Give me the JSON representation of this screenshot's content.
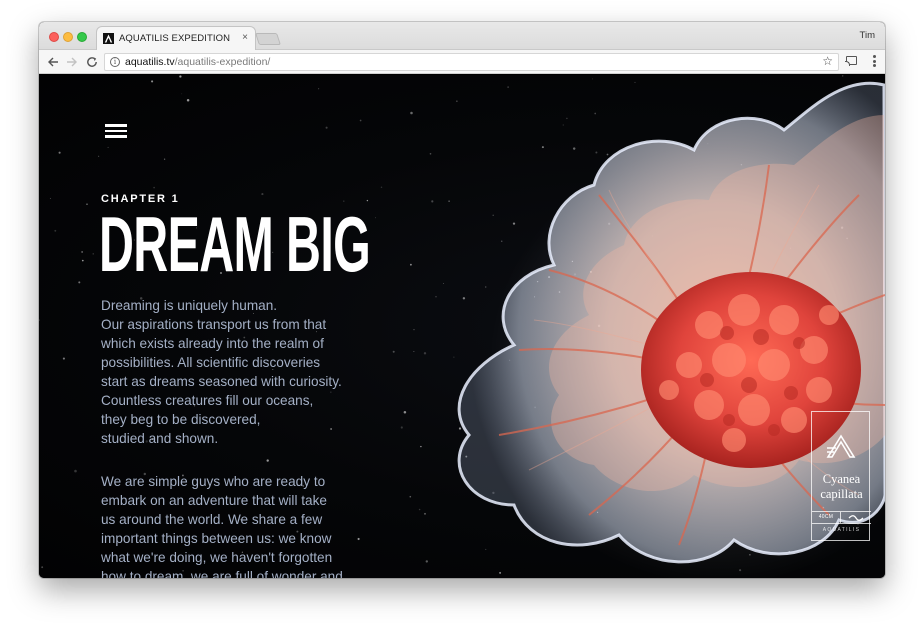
{
  "browser": {
    "tab_title": "AQUATILIS EXPEDITION",
    "tab_close": "×",
    "profile_name": "Tim",
    "url_host": "aquatilis.tv",
    "url_path": "/aquatilis-expedition/",
    "icons": [
      "back-arrow-icon",
      "forward-arrow-icon",
      "reload-icon",
      "info-icon",
      "star-icon",
      "cast-icon",
      "kebab-menu-icon",
      "aquatilis-favicon",
      "close-icon"
    ],
    "colors": {
      "traffic_red": "#fc605c",
      "traffic_yellow": "#fdbc40",
      "traffic_green": "#34c84a"
    }
  },
  "page": {
    "menu_icon": "hamburger-icon",
    "chapter": "CHAPTER 1",
    "headline": "DREAM BIG",
    "paragraph1": [
      "Dreaming is uniquely human.",
      "Our aspirations transport us from that",
      "which exists already into the realm of",
      "possibilities. All scientific discoveries",
      "start as dreams seasoned with curiosity.",
      "Countless creatures fill our oceans,",
      "they beg to be discovered,",
      "studied and shown."
    ],
    "paragraph2": [
      "We are simple guys who are ready to",
      "embark on an adventure that will take",
      "us around the world. We share a few",
      "important things between us: we know",
      "what we're doing, we haven't forgotten",
      "how to dream, we are full of wonder and"
    ],
    "species_card": {
      "name_line1": "Cyanea",
      "name_line2": "capillata",
      "size": "40CM",
      "brand": "AQUATILIS"
    },
    "colors": {
      "background": "#050608",
      "headline": "#ffffff",
      "body_text": "#a4b0c6",
      "jellyfish_core": "#e0443c"
    }
  }
}
